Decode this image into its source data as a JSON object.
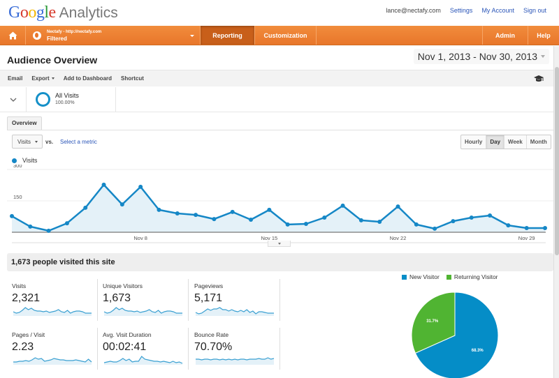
{
  "app": {
    "logo_google_letters": [
      "G",
      "o",
      "o",
      "g",
      "l",
      "e"
    ],
    "product_name": "Analytics"
  },
  "user": {
    "email": "lance@nectafy.com",
    "links": [
      "Settings",
      "My Account",
      "Sign out"
    ]
  },
  "nav": {
    "account_name": "Nectafy - http://nectafy.com",
    "view_name": "Filtered",
    "tabs": [
      "Reporting",
      "Customization"
    ],
    "active_tab": "Reporting",
    "right_tabs": [
      "Admin",
      "Help"
    ]
  },
  "page": {
    "title": "Audience Overview",
    "date_range": "Nov 1, 2013 - Nov 30, 2013"
  },
  "toolbar": {
    "email": "Email",
    "export": "Export",
    "add_to_dashboard": "Add to Dashboard",
    "shortcut": "Shortcut"
  },
  "segment": {
    "name": "All Visits",
    "percent": "100.00%",
    "color": "#1590c8"
  },
  "tabs": {
    "overview": "Overview"
  },
  "metric_picker": {
    "selected": "Visits",
    "vs_label": "vs.",
    "select_metric": "Select a metric"
  },
  "granularity": {
    "options": [
      "Hourly",
      "Day",
      "Week",
      "Month"
    ],
    "active": "Day"
  },
  "chart_data": [
    {
      "type": "area",
      "title": "",
      "legend": [
        "Visits"
      ],
      "legend_position": "top-left",
      "color": "#1587c6",
      "fill_color": "#e4f1f8",
      "x": [
        "Nov 1",
        "Nov 2",
        "Nov 3",
        "Nov 4",
        "Nov 5",
        "Nov 6",
        "Nov 7",
        "Nov 8",
        "Nov 9",
        "Nov 10",
        "Nov 11",
        "Nov 12",
        "Nov 13",
        "Nov 14",
        "Nov 15",
        "Nov 16",
        "Nov 17",
        "Nov 18",
        "Nov 19",
        "Nov 20",
        "Nov 21",
        "Nov 22",
        "Nov 23",
        "Nov 24",
        "Nov 25",
        "Nov 26",
        "Nov 27",
        "Nov 28",
        "Nov 29",
        "Nov 30"
      ],
      "series": [
        {
          "name": "Visits",
          "values": [
            77,
            27,
            7,
            43,
            117,
            227,
            133,
            217,
            107,
            90,
            83,
            63,
            97,
            60,
            107,
            37,
            40,
            70,
            127,
            57,
            50,
            123,
            37,
            17,
            53,
            70,
            80,
            33,
            20,
            20
          ]
        }
      ],
      "x_tick_labels": [
        "Nov 8",
        "Nov 15",
        "Nov 22",
        "Nov 29"
      ],
      "y_tick_labels": [
        "150",
        "300"
      ],
      "y_ticks": [
        150,
        300
      ],
      "ylim": [
        0,
        300
      ],
      "grid": true
    },
    {
      "type": "pie",
      "title": "",
      "legend_position": "top",
      "categories": [
        "New Visitor",
        "Returning Visitor"
      ],
      "values": [
        68.3,
        31.7
      ],
      "labels": [
        "68.3%",
        "31.7%"
      ],
      "colors": [
        "#058dc7",
        "#50b432"
      ]
    }
  ],
  "summary": {
    "headline": "1,673 people visited this site",
    "cards": [
      {
        "label": "Visits",
        "value": "2,321",
        "spark": [
          6,
          4,
          5,
          8,
          12,
          9,
          11,
          8,
          7,
          7,
          6,
          7,
          5,
          6,
          7,
          9,
          6,
          5,
          8,
          4,
          6,
          7,
          7,
          6,
          4,
          4,
          4
        ]
      },
      {
        "label": "Unique Visitors",
        "value": "1,673",
        "spark": [
          6,
          4,
          5,
          8,
          12,
          9,
          11,
          8,
          7,
          7,
          6,
          7,
          5,
          6,
          7,
          9,
          6,
          5,
          8,
          4,
          6,
          7,
          7,
          6,
          4,
          4,
          4
        ]
      },
      {
        "label": "Pageviews",
        "value": "5,171",
        "spark": [
          5,
          3,
          4,
          7,
          10,
          8,
          10,
          10,
          12,
          9,
          9,
          7,
          9,
          7,
          6,
          8,
          6,
          9,
          5,
          7,
          3,
          6,
          6,
          5,
          4,
          4,
          4
        ]
      },
      {
        "label": "Pages / Visit",
        "value": "2.23",
        "spark": [
          4,
          4,
          5,
          5,
          6,
          5,
          7,
          10,
          8,
          9,
          5,
          6,
          7,
          9,
          8,
          7,
          7,
          6,
          6,
          6,
          7,
          6,
          5,
          4,
          8,
          4
        ]
      },
      {
        "label": "Avg. Visit Duration",
        "value": "00:02:41",
        "spark": [
          3,
          4,
          5,
          4,
          4,
          6,
          9,
          6,
          8,
          4,
          5,
          5,
          12,
          8,
          7,
          6,
          5,
          5,
          4,
          5,
          4,
          3,
          5,
          3,
          4,
          2
        ]
      },
      {
        "label": "Bounce Rate",
        "value": "70.70%",
        "spark": [
          8,
          8,
          7,
          8,
          8,
          7,
          8,
          8,
          7,
          8,
          7,
          8,
          7,
          8,
          7,
          8,
          8,
          7,
          8,
          8,
          8,
          9,
          8,
          8,
          10,
          8,
          9
        ]
      }
    ]
  }
}
